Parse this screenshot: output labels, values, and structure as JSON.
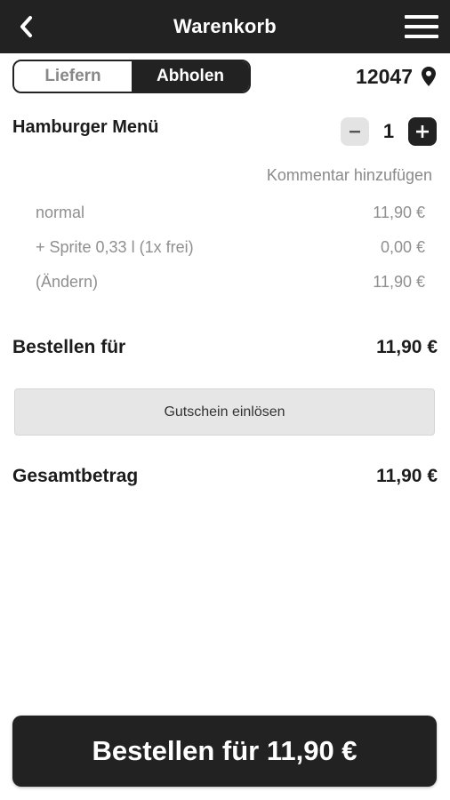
{
  "header": {
    "title": "Warenkorb",
    "back_icon": "chevron-left-icon",
    "menu_icon": "hamburger-menu-icon"
  },
  "delivery_toggle": {
    "options": [
      "Liefern",
      "Abholen"
    ],
    "selected": "Abholen"
  },
  "location": {
    "postal_code": "12047",
    "icon": "location-pin-icon"
  },
  "cart_item": {
    "name": "Hamburger Menü",
    "quantity": "1",
    "comment_link": "Kommentar hinzufügen",
    "details": [
      {
        "label": "normal",
        "price": "11,90 €"
      },
      {
        "label": "+ Sprite 0,33 l (1x frei)",
        "price": "0,00 €"
      },
      {
        "label": "(Ändern)",
        "price": "11,90 €"
      }
    ]
  },
  "order_for": {
    "label": "Bestellen für",
    "value": "11,90 €"
  },
  "voucher_button": {
    "label": "Gutschein einlösen"
  },
  "total": {
    "label": "Gesamtbetrag",
    "value": "11,90 €"
  },
  "order_button": {
    "label": "Bestellen für 11,90 €"
  },
  "colors": {
    "primary": "#222222",
    "muted_text": "#8f8f8f",
    "button_gray": "#e6e6e6"
  }
}
